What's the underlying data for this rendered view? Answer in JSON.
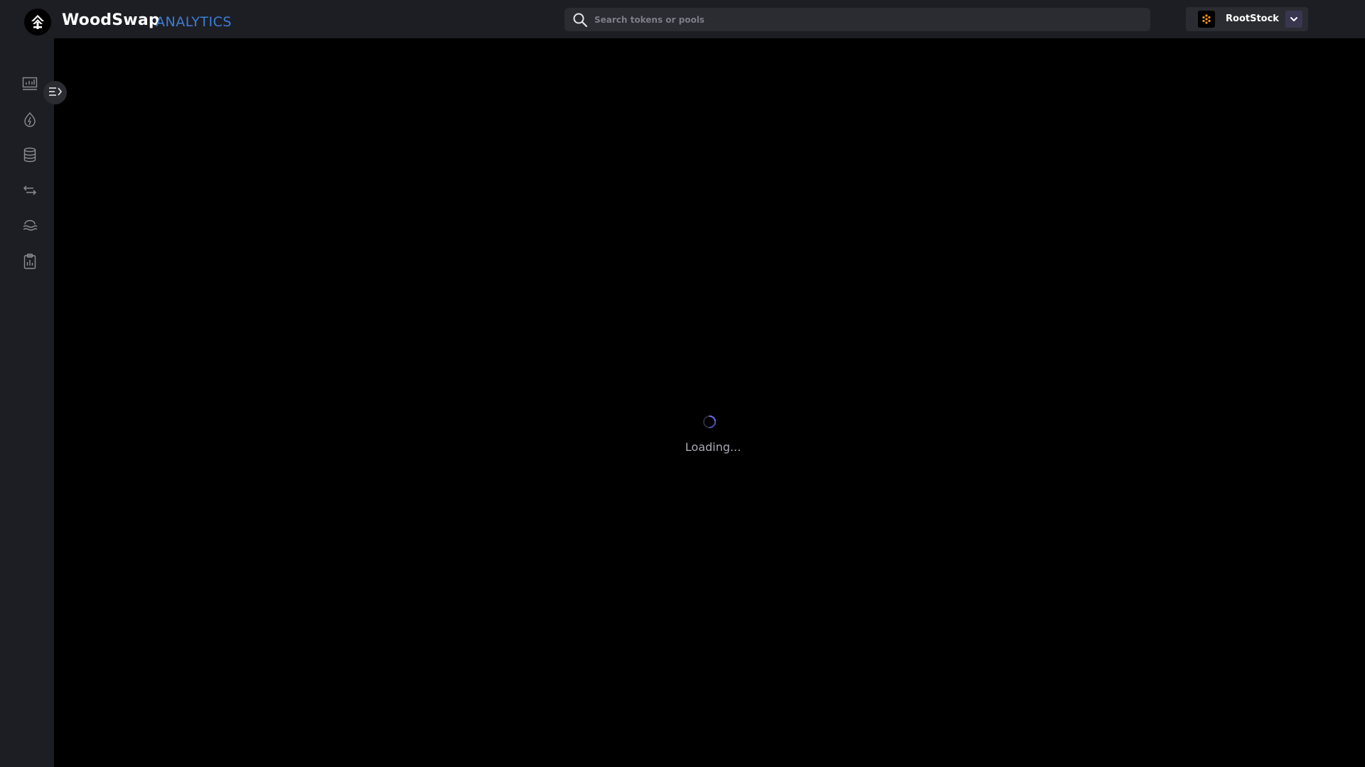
{
  "header": {
    "brand_name": "WoodSwap",
    "brand_suffix": "ANALYTICS",
    "logo_icon": "woodswap-logo-icon"
  },
  "search": {
    "placeholder": "Search tokens or pools",
    "value": "",
    "icon": "search-icon"
  },
  "network": {
    "name": "RootStock",
    "icon": "rootstock-logo-icon",
    "dropdown_icon": "chevron-down-icon"
  },
  "sidebar": {
    "items": [
      {
        "icon": "chart-icon"
      },
      {
        "icon": "flame-icon"
      },
      {
        "icon": "database-icon"
      },
      {
        "icon": "swap-arrows-icon"
      },
      {
        "icon": "pools-icon"
      },
      {
        "icon": "clipboard-icon"
      }
    ],
    "toggle_icon": "expand-sidebar-icon"
  },
  "status": {
    "loading_text": "Loading..."
  },
  "colors": {
    "background": "#000000",
    "panel": "#1d1e23",
    "accent": "#3d7dd8",
    "spinner": "#6a6cf0",
    "network_accent": "#f7931a"
  }
}
